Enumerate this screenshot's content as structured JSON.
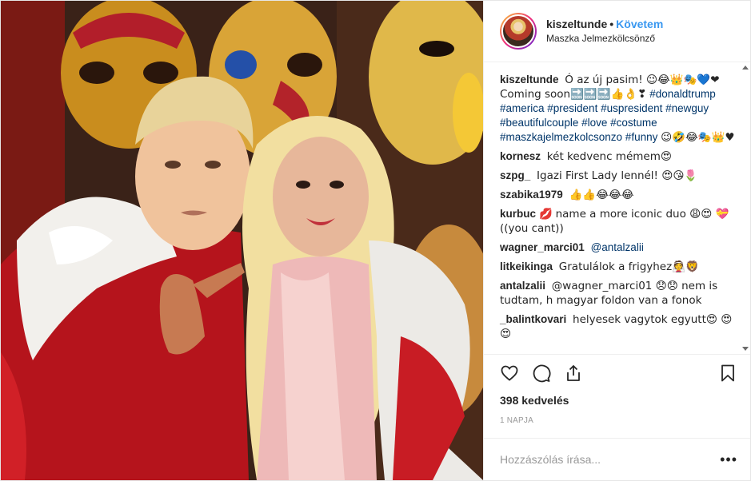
{
  "post": {
    "username": "kiszeltunde",
    "dot": "•",
    "follow_label": "Követem",
    "location": "Maszka Jelmezkölcsönző",
    "caption": {
      "user": "kiszeltunde",
      "text": "Ó az új pasim! 😉😂👑🎭💙❤ Coming soon🔜🔜🔜👍👌❣",
      "hashtags": "#donaldtrump #america #president #uspresident #newguy #beautifulcouple #love #costume #maszkajelmezkolcsonzo #funny",
      "suffix": "😉🤣😂🎭👑♥"
    },
    "comments": [
      {
        "user": "kornesz",
        "text": "két kedvenc mémem😍"
      },
      {
        "user": "szpg_",
        "text": "Igazi First Lady lennél! 😍😘🌷"
      },
      {
        "user": "szabika1979",
        "text": "👍👍😂😂😂"
      },
      {
        "user": "kurbuc",
        "badge": "💋",
        "text": "name a more iconic duo 😩😍 💝 ((you cant))"
      },
      {
        "user": "wagner_marci01",
        "text": "@antalzalii"
      },
      {
        "user": "litkeikinga",
        "text": "Gratulálok a frigyhez👰🦁"
      },
      {
        "user": "antalzalii",
        "text": "@wagner_marci01 😞😞 nem is tudtam, h magyar foldon van a fonok"
      },
      {
        "user": "_balintkovari",
        "text": "helyesek vagytok egyutt😍 😍😍"
      }
    ],
    "likes": "398 kedvelés",
    "time": "1 NAPJA",
    "comment_placeholder": "Hozzászólás írása...",
    "more_label": "•••"
  },
  "icons": {
    "like": "heart-icon",
    "comment": "comment-icon",
    "share": "share-icon",
    "save": "bookmark-icon",
    "more": "more-options-icon"
  },
  "colors": {
    "link": "#3897f0",
    "hashtag": "#003569",
    "text": "#262626",
    "muted": "#999999"
  }
}
